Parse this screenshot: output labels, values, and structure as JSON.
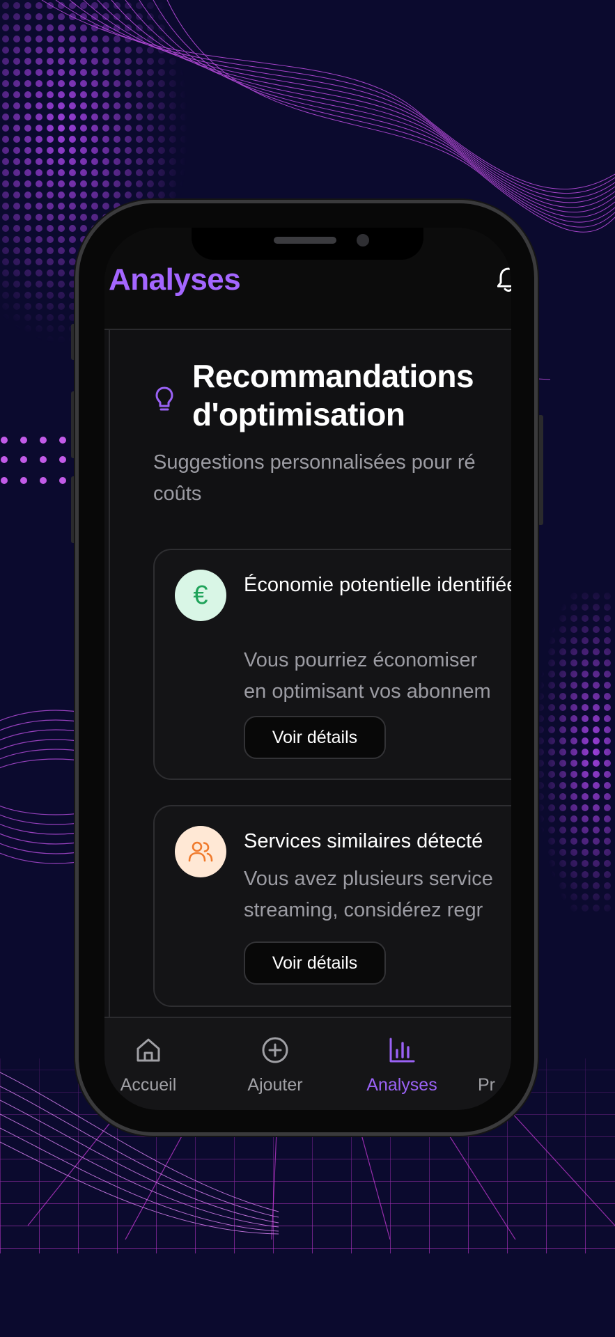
{
  "header": {
    "title": "Analyses",
    "bell_icon": "bell-icon"
  },
  "section": {
    "icon": "lightbulb-icon",
    "title": "Recommandations d'optimisation",
    "subtitle": "Suggestions personnalisées pour ré coûts"
  },
  "recommendations": [
    {
      "icon": "euro-icon",
      "icon_glyph": "€",
      "title": "Économie potentielle identifiée",
      "description_lines": [
        "Vous pourriez économiser",
        "en optimisant vos abonnem"
      ],
      "button_label": "Voir détails"
    },
    {
      "icon": "users-icon",
      "title": "Services similaires détecté",
      "description_lines": [
        "Vous avez plusieurs service",
        "streaming, considérez regr"
      ],
      "button_label": "Voir détails"
    }
  ],
  "tabs": [
    {
      "label": "Accueil",
      "icon": "home-icon",
      "active": false
    },
    {
      "label": "Ajouter",
      "icon": "plus-circle-icon",
      "active": false
    },
    {
      "label": "Analyses",
      "icon": "bar-chart-icon",
      "active": true
    },
    {
      "label": "Pr",
      "icon": "profile-icon",
      "active": false
    }
  ],
  "colors": {
    "background": "#0b0a2e",
    "accent": "#a466ff",
    "euro_icon": "#1fa35a",
    "users_icon": "#f07a2c"
  }
}
